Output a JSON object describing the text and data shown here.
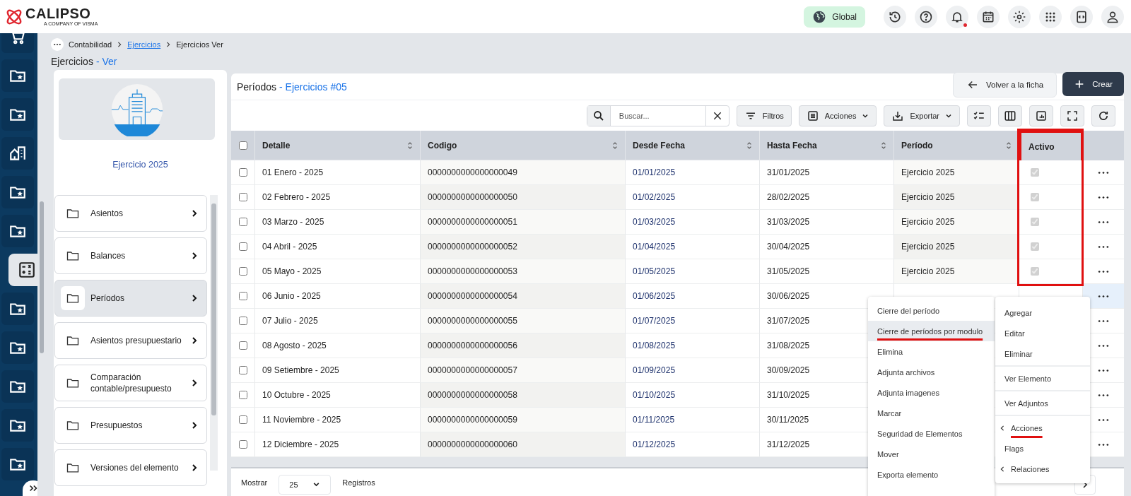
{
  "topbar": {
    "logo": "CALIPSO",
    "tagline": "A COMPANY OF VISMA",
    "scope": "Global",
    "notification_dot": true
  },
  "nav": {
    "items": [
      {
        "kind": "cart",
        "selected": false
      },
      {
        "kind": "folder",
        "selected": false
      },
      {
        "kind": "folder",
        "selected": false
      },
      {
        "kind": "building",
        "selected": false
      },
      {
        "kind": "folder",
        "selected": false
      },
      {
        "kind": "folder",
        "selected": false
      },
      {
        "kind": "calculator",
        "selected": true
      },
      {
        "kind": "folder",
        "selected": false
      },
      {
        "kind": "folder",
        "selected": false
      },
      {
        "kind": "folder",
        "selected": false
      },
      {
        "kind": "folder",
        "selected": false
      },
      {
        "kind": "folder",
        "selected": false
      }
    ]
  },
  "breadcrumb": [
    {
      "label": "Contabilidad",
      "link": false
    },
    {
      "label": "Ejercicios",
      "link": true
    },
    {
      "label": "Ejercicios Ver",
      "link": false
    }
  ],
  "page_title": {
    "title": "Ejercicios",
    "suffix": "- Ver"
  },
  "record": {
    "name": "Ejercicio 2025",
    "sections": [
      {
        "label": "Asientos",
        "selected": false
      },
      {
        "label": "Balances",
        "selected": false
      },
      {
        "label": "Períodos",
        "selected": true
      },
      {
        "label": "Asientos presupuestario",
        "selected": false
      },
      {
        "label": "Comparación contable/presupuesto",
        "selected": false
      },
      {
        "label": "Presupuestos",
        "selected": false
      },
      {
        "label": "Versiones del elemento",
        "selected": false
      }
    ]
  },
  "panel": {
    "title": "Períodos",
    "subtitle": "- Ejercicios #05",
    "back_button": "Volver a la ficha",
    "create_button": "Crear",
    "search": {
      "placeholder": "Buscar..."
    },
    "filter_button": "Filtros",
    "actions_button": "Acciones",
    "export_button": "Exportar"
  },
  "table": {
    "all_selected": false,
    "columns": [
      {
        "label": "Detalle",
        "sortable": true,
        "highlighted": false
      },
      {
        "label": "Codigo",
        "sortable": true,
        "highlighted": false
      },
      {
        "label": "Desde Fecha",
        "sortable": true,
        "highlighted": false
      },
      {
        "label": "Hasta Fecha",
        "sortable": true,
        "highlighted": false
      },
      {
        "label": "Período",
        "sortable": true,
        "highlighted": false
      },
      {
        "label": "Activo",
        "sortable": false,
        "highlighted": true
      }
    ],
    "rows": [
      {
        "detalle": "01 Enero - 2025",
        "codigo": "0000000000000000049",
        "desde": "01/01/2025",
        "hasta": "31/01/2025",
        "periodo": "Ejercicio 2025",
        "active": true,
        "selected": false,
        "menu_open": false
      },
      {
        "detalle": "02 Febrero - 2025",
        "codigo": "0000000000000000050",
        "desde": "01/02/2025",
        "hasta": "28/02/2025",
        "periodo": "Ejercicio 2025",
        "active": true,
        "selected": false,
        "menu_open": false
      },
      {
        "detalle": "03 Marzo - 2025",
        "codigo": "0000000000000000051",
        "desde": "01/03/2025",
        "hasta": "31/03/2025",
        "periodo": "Ejercicio 2025",
        "active": true,
        "selected": false,
        "menu_open": false
      },
      {
        "detalle": "04 Abril - 2025",
        "codigo": "0000000000000000052",
        "desde": "01/04/2025",
        "hasta": "30/04/2025",
        "periodo": "Ejercicio 2025",
        "active": true,
        "selected": false,
        "menu_open": false
      },
      {
        "detalle": "05 Mayo - 2025",
        "codigo": "0000000000000000053",
        "desde": "01/05/2025",
        "hasta": "31/05/2025",
        "periodo": "Ejercicio 2025",
        "active": true,
        "selected": false,
        "menu_open": false
      },
      {
        "detalle": "06 Junio - 2025",
        "codigo": "0000000000000000054",
        "desde": "01/06/2025",
        "hasta": "30/06/2025",
        "selected": false,
        "menu_open": true
      },
      {
        "detalle": "07 Julio - 2025",
        "codigo": "0000000000000000055",
        "desde": "01/07/2025",
        "hasta": "31/07/2025",
        "selected": false,
        "menu_open": false
      },
      {
        "detalle": "08 Agosto - 2025",
        "codigo": "0000000000000000056",
        "desde": "01/08/2025",
        "hasta": "31/08/2025",
        "selected": false,
        "menu_open": false
      },
      {
        "detalle": "09 Setiembre - 2025",
        "codigo": "0000000000000000057",
        "desde": "01/09/2025",
        "hasta": "30/09/2025",
        "selected": false,
        "menu_open": false
      },
      {
        "detalle": "10 Octubre - 2025",
        "codigo": "0000000000000000058",
        "desde": "01/10/2025",
        "hasta": "31/10/2025",
        "selected": false,
        "menu_open": false
      },
      {
        "detalle": "11 Noviembre - 2025",
        "codigo": "0000000000000000059",
        "desde": "01/11/2025",
        "hasta": "30/11/2025",
        "selected": false,
        "menu_open": false
      },
      {
        "detalle": "12 Diciembre - 2025",
        "codigo": "0000000000000000060",
        "desde": "01/12/2025",
        "hasta": "31/12/2025",
        "selected": false,
        "menu_open": false
      }
    ]
  },
  "footer": {
    "label": "Mostrar",
    "page_size": "25",
    "suffix": "Registros"
  },
  "actions_menu": {
    "items": [
      {
        "label": "Cierre del período",
        "hovered": false,
        "underlined": false
      },
      {
        "label": "Cierre de períodos por modulo",
        "hovered": true,
        "underlined": true
      },
      {
        "label": "Elimina",
        "hovered": false,
        "underlined": false
      },
      {
        "label": "Adjunta archivos",
        "hovered": false,
        "underlined": false
      },
      {
        "label": "Adjunta imagenes",
        "hovered": false,
        "underlined": false
      },
      {
        "label": "Marcar",
        "hovered": false,
        "underlined": false
      },
      {
        "label": "Seguridad de Elementos",
        "hovered": false,
        "underlined": false
      },
      {
        "label": "Mover",
        "hovered": false,
        "underlined": false
      },
      {
        "label": "Exporta elemento",
        "hovered": false,
        "underlined": false
      }
    ]
  },
  "context_menu": {
    "groups": [
      {
        "items": [
          {
            "label": "Agregar",
            "kind": "item",
            "underlined": false
          },
          {
            "label": "Editar",
            "kind": "item",
            "underlined": false
          },
          {
            "label": "Eliminar",
            "kind": "item",
            "underlined": false
          }
        ]
      },
      {
        "items": [
          {
            "label": "Ver Elemento",
            "kind": "item",
            "underlined": false
          }
        ]
      },
      {
        "items": [
          {
            "label": "Ver Adjuntos",
            "kind": "item",
            "underlined": false
          }
        ]
      },
      {
        "items": [
          {
            "label": "Acciones",
            "kind": "submenu",
            "underlined": true
          },
          {
            "label": "Flags",
            "kind": "item",
            "underlined": false
          },
          {
            "label": "Relaciones",
            "kind": "submenu",
            "underlined": false
          }
        ]
      }
    ]
  }
}
